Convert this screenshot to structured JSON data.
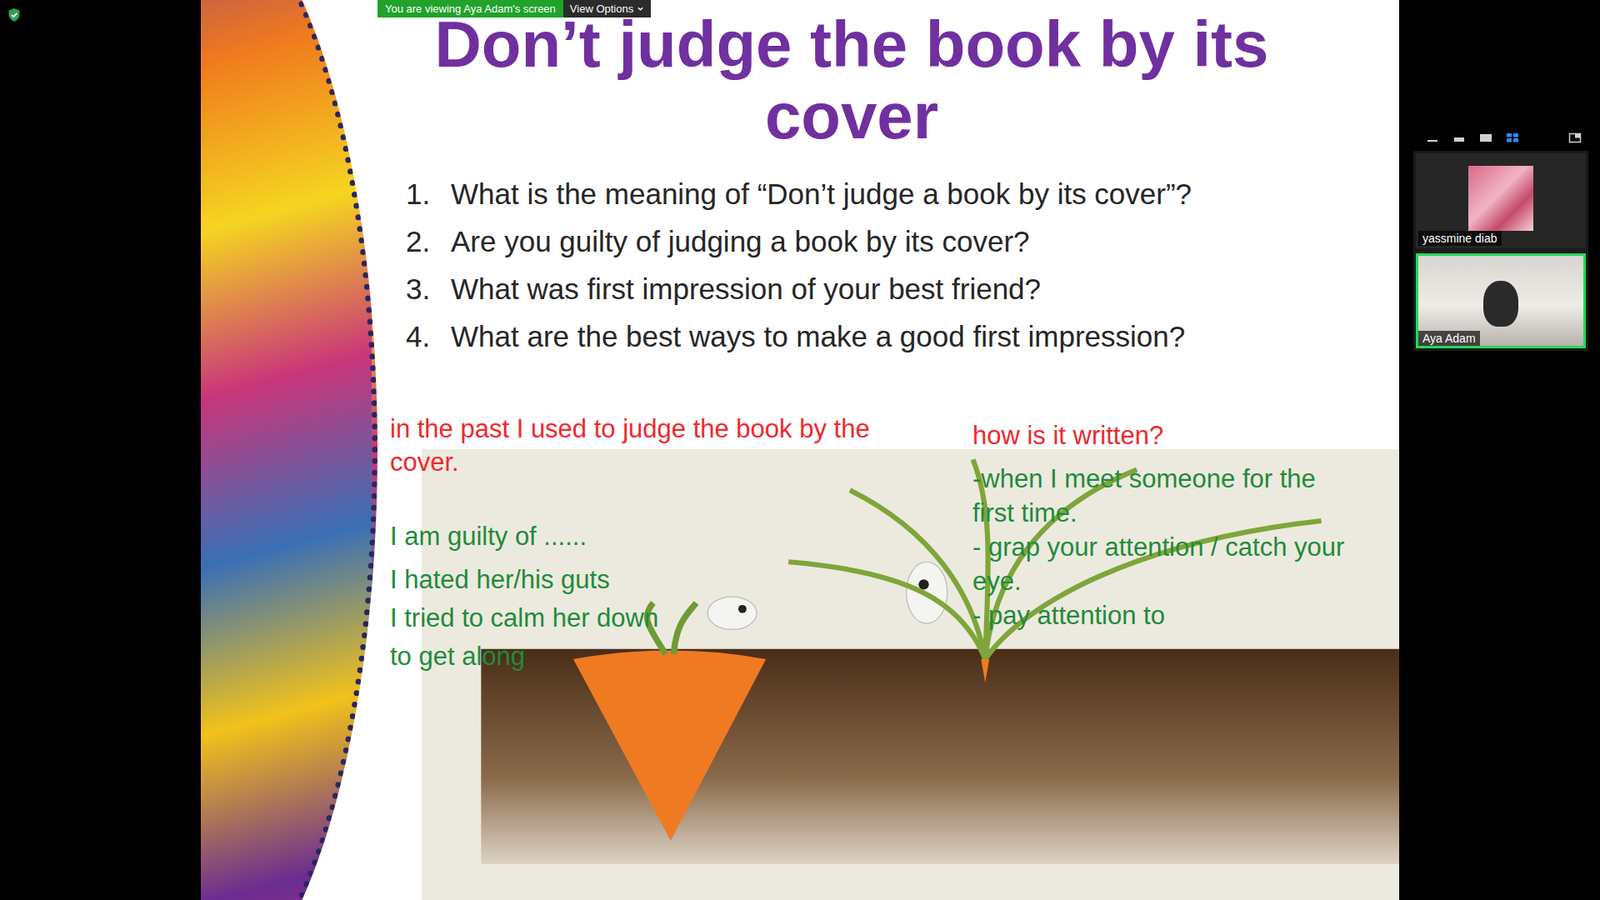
{
  "banner": {
    "text": "You are viewing Aya Adam's screen",
    "view_options": "View Options"
  },
  "slide": {
    "title": [
      "Don’t judge the book by its",
      "cover"
    ],
    "questions": [
      {
        "number": "1.",
        "text": "What is the meaning of “Don’t judge a book by its cover”?"
      },
      {
        "number": "2.",
        "text": "Are you guilty of judging a book by its cover?"
      },
      {
        "number": "3.",
        "text": "What was first impression of your best friend?"
      },
      {
        "number": "4.",
        "text": "What are the best ways to make a good first impression?"
      }
    ],
    "notes_left": [
      {
        "text": "in the past I used to judge the book by the cover.",
        "color": "#f0282d"
      },
      {
        "text": "I am guilty of ......",
        "color": "#228b3b"
      },
      {
        "text": "I hated her/his guts",
        "color": "#228b3b"
      },
      {
        "text": "I tried to calm her down",
        "color": "#228b3b"
      },
      {
        "text": "to get along",
        "color": "#228b3b"
      }
    ],
    "notes_right": [
      {
        "text": "how is it written?",
        "color": "#f0282d"
      },
      {
        "text": "-when I meet someone for the first time.",
        "color": "#228b3b"
      },
      {
        "text": "- grap your attention / catch your eye.",
        "color": "#228b3b"
      },
      {
        "text": "- pay attention to",
        "color": "#228b3b"
      }
    ]
  },
  "layout_views": [
    {
      "selected": false
    },
    {
      "selected": false
    },
    {
      "selected": false
    },
    {
      "selected": true
    },
    {
      "selected": false
    }
  ],
  "participants": [
    {
      "name": "yassmine diab",
      "kind": "photo",
      "active_speaker": false
    },
    {
      "name": "Aya Adam",
      "kind": "video",
      "active_speaker": true
    }
  ]
}
